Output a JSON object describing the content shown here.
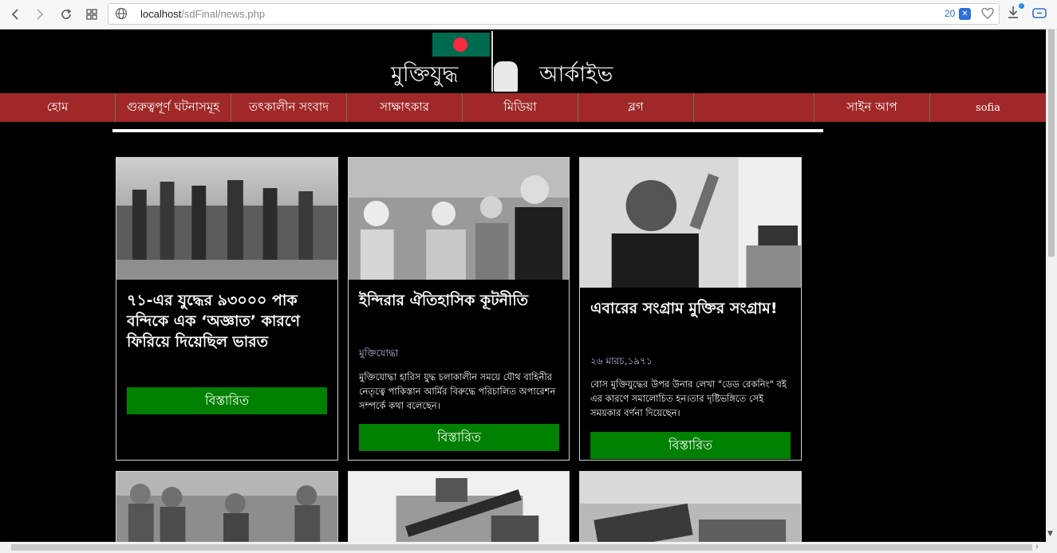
{
  "browser": {
    "url_host": "localhost",
    "url_path": "/sdFinal/news.php",
    "tracker_count": "20"
  },
  "logo": {
    "text_left": "মুক্তিযুদ্ধ",
    "text_right": "আর্কাইভ"
  },
  "nav": {
    "items": [
      "হোম",
      "গুরুত্বপূর্ণ ঘটনাসমূহ",
      "তৎকালীন সংবাদ",
      "সাক্ষাৎকার",
      "মিডিয়া",
      "ব্লগ",
      "সাইন আপ"
    ],
    "user": "sofia"
  },
  "cards": [
    {
      "title": "৭১-এর যুদ্ধের ৯৩০০০ পাক বন্দিকে এক ‘অজ্ঞাত’ কারণে ফিরিয়ে দিয়েছিল ভারত",
      "meta": "",
      "desc": "",
      "button": "বিস্তারিত"
    },
    {
      "title": "ইন্দিরার ঐতিহাসিক কূটনীতি",
      "meta": "মুক্তিযোদ্ধা",
      "desc": "মুক্তিযোদ্ধা হারিস যুদ্ধ চলাকালীন সময়ে যৌথ বাহিনীর নেতৃত্বে পাকিস্তান আর্মির বিরুদ্ধে পরিচালিত অপারেশন সম্পর্কে কথা বলেছেন।",
      "button": "বিস্তারিত"
    },
    {
      "title": "এবারের সংগ্রাম মুক্তির সংগ্রাম!",
      "meta": "২৬ মারচ,১৯৭১",
      "desc": "বোস মুক্তিযুদ্ধের উপর উনার লেখা \"ডেড রেকনিং\" বই এর কারণে সমালোচিত হন।তার দৃষ্টিভঙ্গিতে সেই সময়কার বর্ণনা দিয়েছেন।",
      "button": "বিস্তারিত"
    }
  ]
}
